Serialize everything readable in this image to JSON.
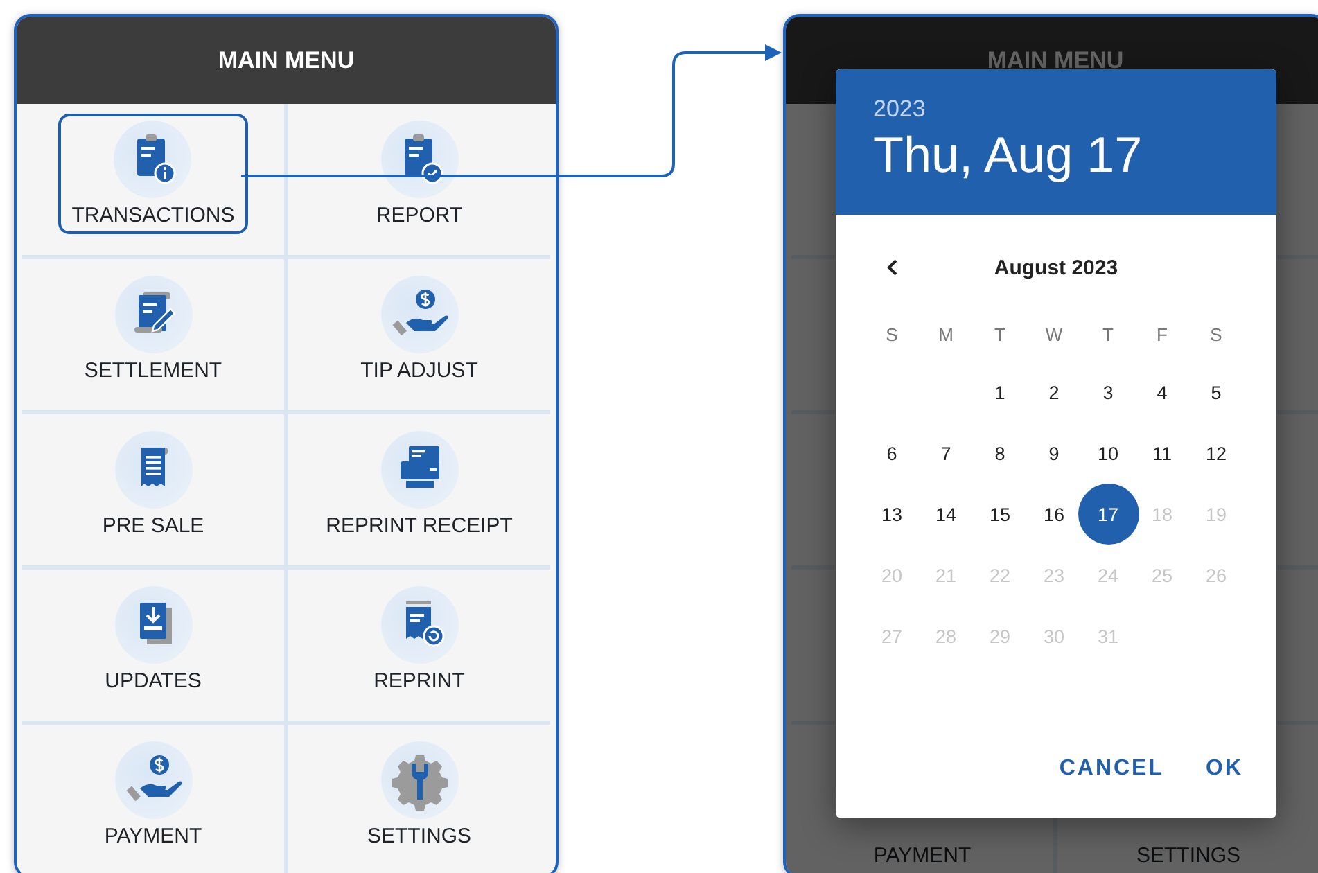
{
  "left_screen": {
    "title": "MAIN MENU",
    "menu_items": [
      {
        "label": "TRANSACTIONS",
        "selected": true
      },
      {
        "label": "REPORT",
        "selected": false
      },
      {
        "label": "SETTLEMENT",
        "selected": false
      },
      {
        "label": "TIP ADJUST",
        "selected": false
      },
      {
        "label": "PRE SALE",
        "selected": false
      },
      {
        "label": "REPRINT RECEIPT",
        "selected": false
      },
      {
        "label": "UPDATES",
        "selected": false
      },
      {
        "label": "REPRINT",
        "selected": false
      },
      {
        "label": "PAYMENT",
        "selected": false
      },
      {
        "label": "SETTINGS",
        "selected": false
      }
    ]
  },
  "right_screen": {
    "title": "MAIN MENU",
    "background_labels": [
      "PAYMENT",
      "SETTINGS"
    ],
    "date_picker": {
      "year": "2023",
      "date_heading": "Thu, Aug 17",
      "month_label": "August 2023",
      "weekdays": [
        "S",
        "M",
        "T",
        "W",
        "T",
        "F",
        "S"
      ],
      "days": [
        {
          "kind": "blank"
        },
        {
          "kind": "blank"
        },
        {
          "kind": "day",
          "label": "1",
          "selected": false,
          "disabled": false
        },
        {
          "kind": "day",
          "label": "2",
          "selected": false,
          "disabled": false
        },
        {
          "kind": "day",
          "label": "3",
          "selected": false,
          "disabled": false
        },
        {
          "kind": "day",
          "label": "4",
          "selected": false,
          "disabled": false
        },
        {
          "kind": "day",
          "label": "5",
          "selected": false,
          "disabled": false
        },
        {
          "kind": "day",
          "label": "6",
          "selected": false,
          "disabled": false
        },
        {
          "kind": "day",
          "label": "7",
          "selected": false,
          "disabled": false
        },
        {
          "kind": "day",
          "label": "8",
          "selected": false,
          "disabled": false
        },
        {
          "kind": "day",
          "label": "9",
          "selected": false,
          "disabled": false
        },
        {
          "kind": "day",
          "label": "10",
          "selected": false,
          "disabled": false
        },
        {
          "kind": "day",
          "label": "11",
          "selected": false,
          "disabled": false
        },
        {
          "kind": "day",
          "label": "12",
          "selected": false,
          "disabled": false
        },
        {
          "kind": "day",
          "label": "13",
          "selected": false,
          "disabled": false
        },
        {
          "kind": "day",
          "label": "14",
          "selected": false,
          "disabled": false
        },
        {
          "kind": "day",
          "label": "15",
          "selected": false,
          "disabled": false
        },
        {
          "kind": "day",
          "label": "16",
          "selected": false,
          "disabled": false
        },
        {
          "kind": "day",
          "label": "17",
          "selected": true,
          "disabled": false
        },
        {
          "kind": "day",
          "label": "18",
          "selected": false,
          "disabled": true
        },
        {
          "kind": "day",
          "label": "19",
          "selected": false,
          "disabled": true
        },
        {
          "kind": "day",
          "label": "20",
          "selected": false,
          "disabled": true
        },
        {
          "kind": "day",
          "label": "21",
          "selected": false,
          "disabled": true
        },
        {
          "kind": "day",
          "label": "22",
          "selected": false,
          "disabled": true
        },
        {
          "kind": "day",
          "label": "23",
          "selected": false,
          "disabled": true
        },
        {
          "kind": "day",
          "label": "24",
          "selected": false,
          "disabled": true
        },
        {
          "kind": "day",
          "label": "25",
          "selected": false,
          "disabled": true
        },
        {
          "kind": "day",
          "label": "26",
          "selected": false,
          "disabled": true
        },
        {
          "kind": "day",
          "label": "27",
          "selected": false,
          "disabled": true
        },
        {
          "kind": "day",
          "label": "28",
          "selected": false,
          "disabled": true
        },
        {
          "kind": "day",
          "label": "29",
          "selected": false,
          "disabled": true
        },
        {
          "kind": "day",
          "label": "30",
          "selected": false,
          "disabled": true
        },
        {
          "kind": "day",
          "label": "31",
          "selected": false,
          "disabled": true
        }
      ],
      "buttons": [
        "CANCEL",
        "OK"
      ]
    }
  }
}
